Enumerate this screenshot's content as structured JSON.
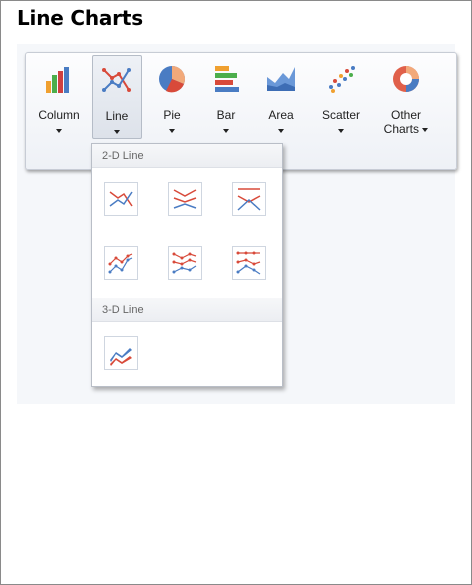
{
  "page": {
    "title": "Line Charts"
  },
  "ribbon": {
    "buttons": [
      {
        "label": "Column",
        "icon": "column-chart-icon"
      },
      {
        "label": "Line",
        "icon": "line-chart-icon",
        "active": true
      },
      {
        "label": "Pie",
        "icon": "pie-chart-icon"
      },
      {
        "label": "Bar",
        "icon": "bar-chart-icon"
      },
      {
        "label": "Area",
        "icon": "area-chart-icon"
      },
      {
        "label": "Scatter",
        "icon": "scatter-chart-icon"
      },
      {
        "label": "Other",
        "label2": "Charts",
        "icon": "other-charts-icon"
      }
    ]
  },
  "dropdown": {
    "sections": [
      {
        "label": "2-D Line",
        "items": [
          "line-icon",
          "stacked-line-icon",
          "100-stacked-line-icon",
          "line-markers-icon",
          "stacked-line-markers-icon",
          "100-stacked-line-markers-icon"
        ]
      },
      {
        "label": "3-D Line",
        "items": [
          "3d-line-icon"
        ]
      }
    ]
  },
  "colors": {
    "accent_blue": "#4a7cc3",
    "accent_red": "#d84a3a",
    "panel_bg": "#f5f7fa"
  }
}
